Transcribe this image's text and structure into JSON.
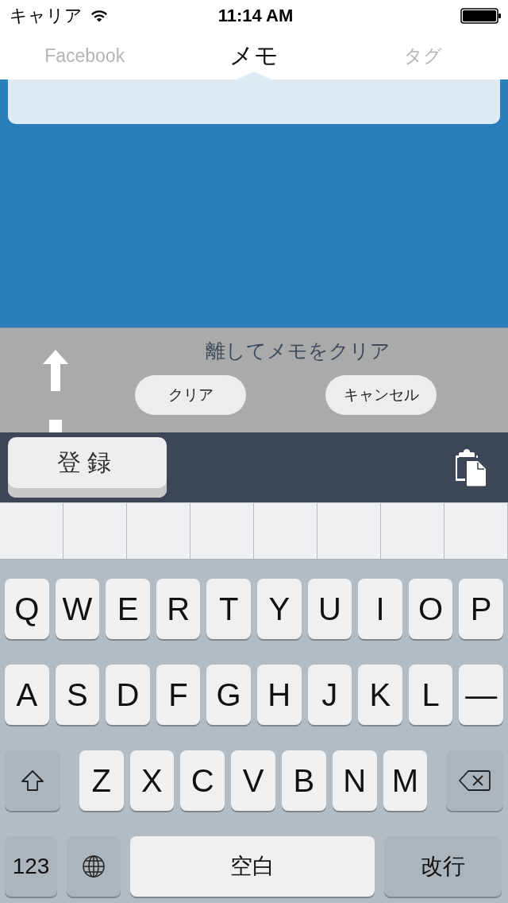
{
  "status_bar": {
    "carrier": "キャリア",
    "time": "11:14 AM"
  },
  "tabs": [
    {
      "label": "Facebook",
      "selected": false
    },
    {
      "label": "メモ",
      "selected": true
    },
    {
      "label": "タグ",
      "selected": false
    }
  ],
  "clear_panel": {
    "message": "離してメモをクリア",
    "buttons": [
      "クリア",
      "キャンセル"
    ]
  },
  "toolbar": {
    "register_button": "登録"
  },
  "keyboard": {
    "rows": [
      {
        "keys": [
          {
            "kind": "char",
            "label": "Q"
          },
          {
            "kind": "char",
            "label": "W"
          },
          {
            "kind": "char",
            "label": "E"
          },
          {
            "kind": "char",
            "label": "R"
          },
          {
            "kind": "char",
            "label": "T"
          },
          {
            "kind": "char",
            "label": "Y"
          },
          {
            "kind": "char",
            "label": "U"
          },
          {
            "kind": "char",
            "label": "I"
          },
          {
            "kind": "char",
            "label": "O"
          },
          {
            "kind": "char",
            "label": "P"
          }
        ]
      },
      {
        "keys": [
          {
            "kind": "char",
            "label": "A"
          },
          {
            "kind": "char",
            "label": "S"
          },
          {
            "kind": "char",
            "label": "D"
          },
          {
            "kind": "char",
            "label": "F"
          },
          {
            "kind": "char",
            "label": "G"
          },
          {
            "kind": "char",
            "label": "H"
          },
          {
            "kind": "char",
            "label": "J"
          },
          {
            "kind": "char",
            "label": "K"
          },
          {
            "kind": "char",
            "label": "L"
          },
          {
            "kind": "char",
            "label": "—"
          }
        ]
      },
      {
        "keys": [
          {
            "kind": "shift"
          },
          {
            "kind": "char",
            "label": "Z"
          },
          {
            "kind": "char",
            "label": "X"
          },
          {
            "kind": "char",
            "label": "C"
          },
          {
            "kind": "char",
            "label": "V"
          },
          {
            "kind": "char",
            "label": "B"
          },
          {
            "kind": "char",
            "label": "N"
          },
          {
            "kind": "char",
            "label": "M"
          },
          {
            "kind": "delete"
          }
        ]
      },
      {
        "keys": [
          {
            "kind": "numbers",
            "label": "123"
          },
          {
            "kind": "globe"
          },
          {
            "kind": "space",
            "label": "空白"
          },
          {
            "kind": "return",
            "label": "改行"
          }
        ]
      }
    ]
  }
}
